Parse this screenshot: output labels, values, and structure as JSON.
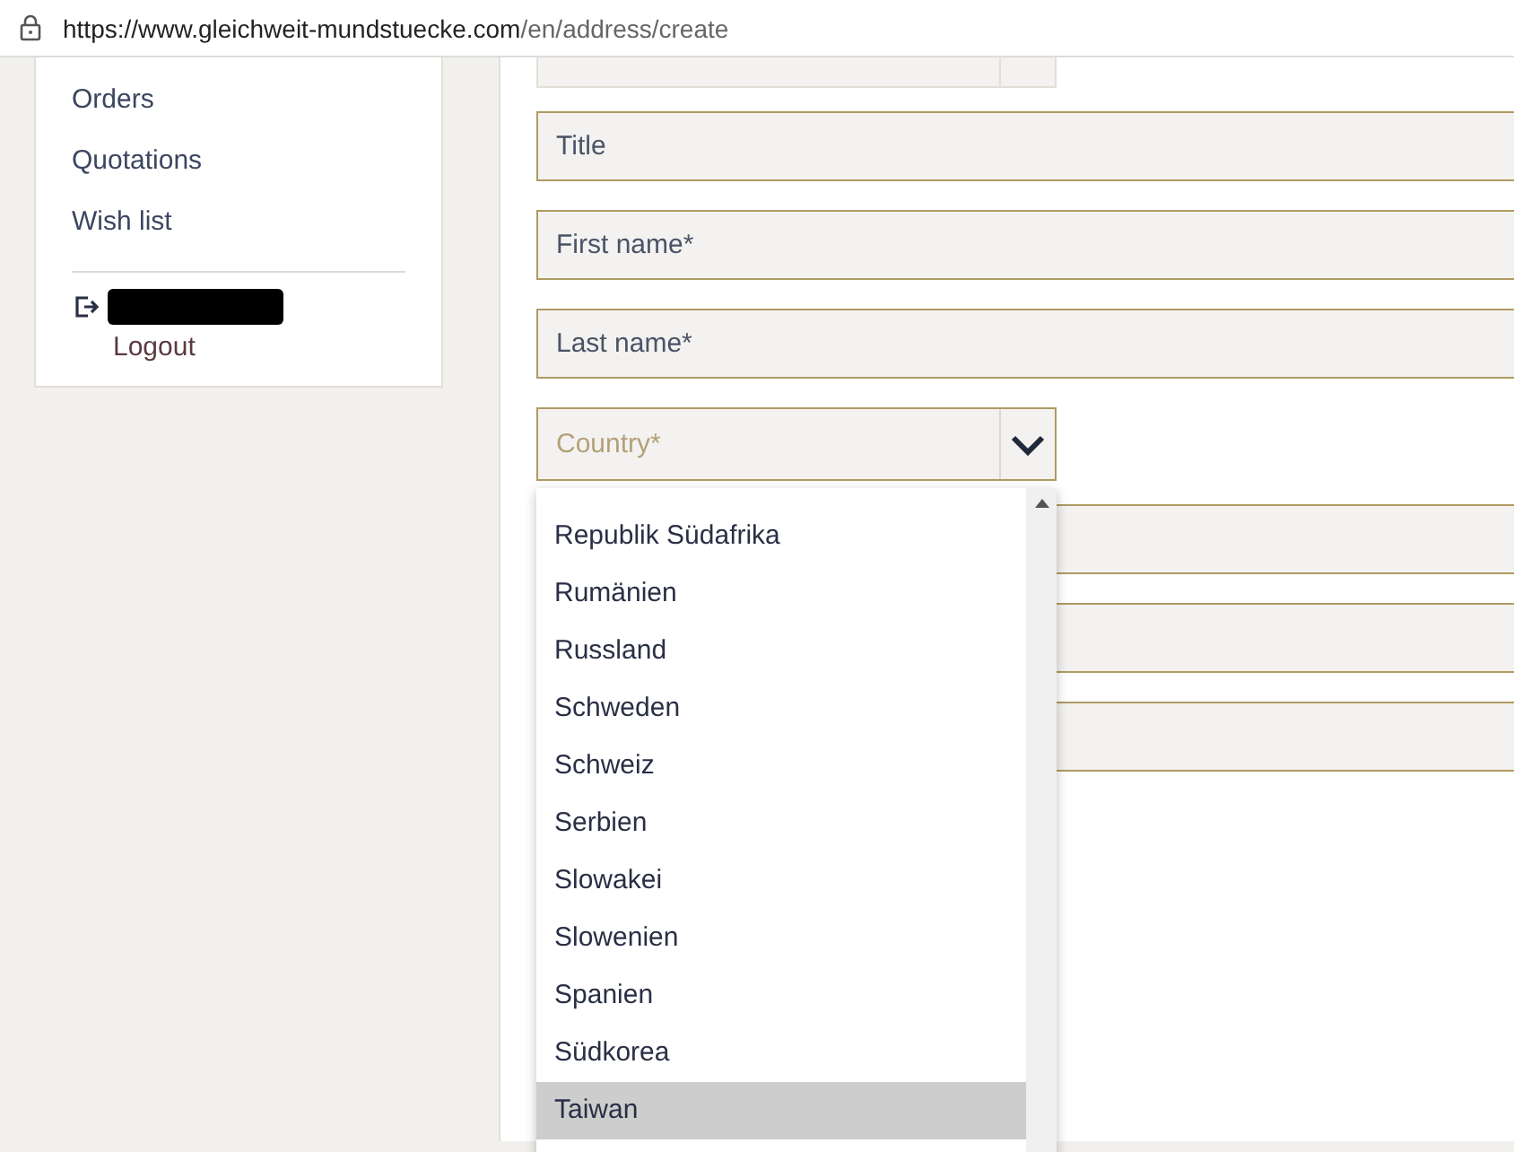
{
  "address_bar": {
    "url_host": "https://www.gleichweit-mundstuecke.com",
    "url_path": "/en/address/create"
  },
  "sidebar": {
    "items": [
      "Orders",
      "Quotations",
      "Wish list"
    ],
    "logout": "Logout"
  },
  "form": {
    "fields": [
      {
        "kind": "select"
      },
      {
        "kind": "text",
        "placeholder": "Title"
      },
      {
        "kind": "text",
        "placeholder": "First name*"
      },
      {
        "kind": "text",
        "placeholder": "Last name*"
      },
      {
        "kind": "select",
        "placeholder": "Country*",
        "expanded": true,
        "options": [
          {
            "label": "Republik Südafrika",
            "selected": false
          },
          {
            "label": "Rumänien",
            "selected": false
          },
          {
            "label": "Russland",
            "selected": false
          },
          {
            "label": "Schweden",
            "selected": false
          },
          {
            "label": "Schweiz",
            "selected": false
          },
          {
            "label": "Serbien",
            "selected": false
          },
          {
            "label": "Slowakei",
            "selected": false
          },
          {
            "label": "Slowenien",
            "selected": false
          },
          {
            "label": "Spanien",
            "selected": false
          },
          {
            "label": "Südkorea",
            "selected": false
          },
          {
            "label": "Taiwan",
            "selected": true
          }
        ]
      },
      {
        "kind": "text"
      },
      {
        "kind": "text"
      },
      {
        "kind": "text"
      }
    ]
  }
}
